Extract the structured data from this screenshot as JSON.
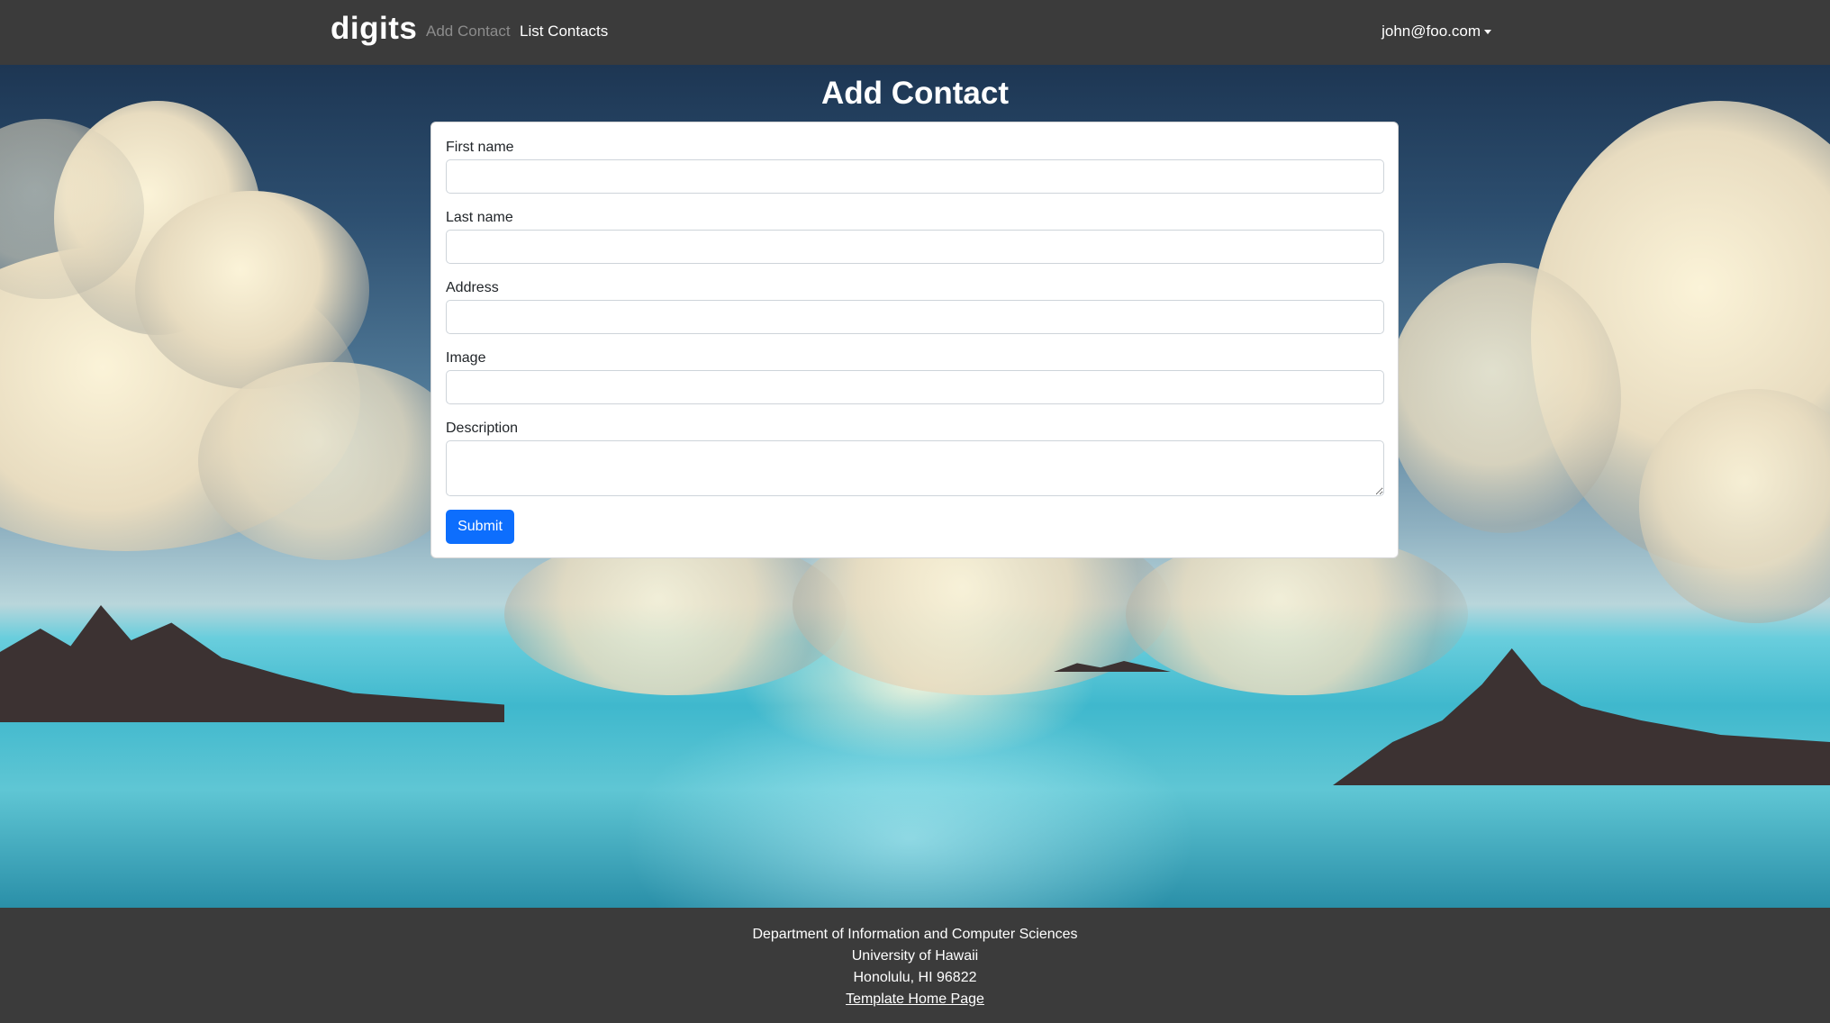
{
  "navbar": {
    "brand": "digits",
    "links": [
      {
        "label": "Add Contact",
        "active": true
      },
      {
        "label": "List Contacts",
        "active": false
      }
    ],
    "user": "john@foo.com"
  },
  "page": {
    "title": "Add Contact"
  },
  "form": {
    "fields": [
      {
        "label": "First name",
        "value": ""
      },
      {
        "label": "Last name",
        "value": ""
      },
      {
        "label": "Address",
        "value": ""
      },
      {
        "label": "Image",
        "value": ""
      },
      {
        "label": "Description",
        "value": ""
      }
    ],
    "submit_label": "Submit",
    "submit_color": "#0d6efd"
  },
  "footer": {
    "lines": [
      "Department of Information and Computer Sciences",
      "University of Hawaii",
      "Honolulu, HI 96822"
    ],
    "link_text": "Template Home Page"
  },
  "colors": {
    "navbar_bg": "#3b3b3b",
    "footer_bg": "#3b3b3b",
    "primary": "#0d6efd"
  }
}
